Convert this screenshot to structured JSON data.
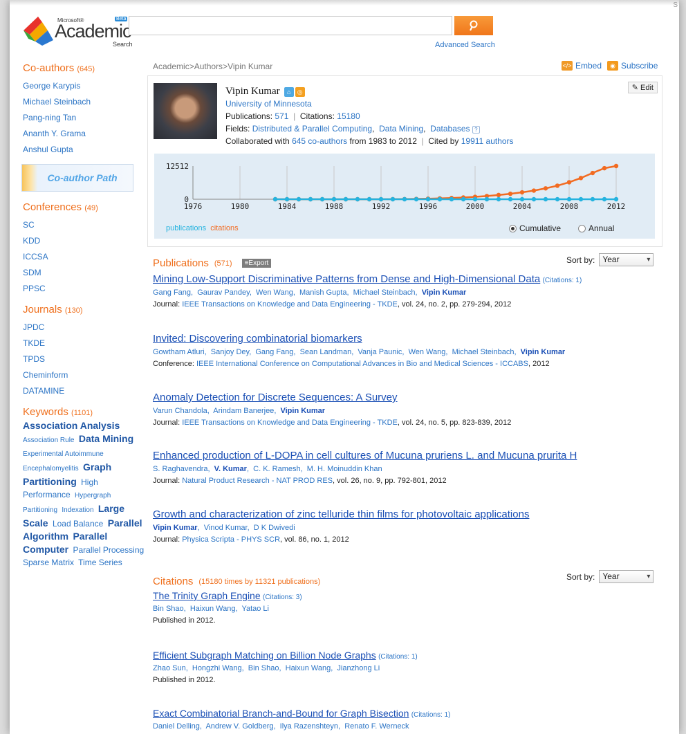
{
  "header": {
    "logo_small": "Microsoft®",
    "logo_beta": "Beta",
    "logo_main": "Academic",
    "logo_sub": "Search",
    "search_placeholder": "",
    "advanced_search": "Advanced Search",
    "corner_text": "S"
  },
  "sidebar": {
    "coauthors": {
      "title": "Co-authors",
      "count": "(645)",
      "items": [
        "George Karypis",
        "Michael Steinbach",
        "Pang-ning Tan",
        "Ananth Y. Grama",
        "Anshul Gupta"
      ]
    },
    "coauthor_path": "Co-author Path",
    "conferences": {
      "title": "Conferences",
      "count": "(49)",
      "items": [
        "SC",
        "KDD",
        "ICCSA",
        "SDM",
        "PPSC"
      ]
    },
    "journals": {
      "title": "Journals",
      "count": "(130)",
      "items": [
        "JPDC",
        "TKDE",
        "TPDS",
        "Cheminform",
        "DATAMINE"
      ]
    },
    "keywords": {
      "title": "Keywords",
      "count": "(1101)",
      "items": [
        {
          "text": "Association Analysis",
          "size": "large"
        },
        {
          "text": "Association Rule",
          "size": "small"
        },
        {
          "text": "Data Mining",
          "size": "large"
        },
        {
          "text": "Experimental Autoimmune Encephalomyelitis",
          "size": "small"
        },
        {
          "text": "Graph Partitioning",
          "size": "large"
        },
        {
          "text": "High Performance",
          "size": "medium"
        },
        {
          "text": "Hypergraph Partitioning",
          "size": "small"
        },
        {
          "text": "Indexation",
          "size": "small"
        },
        {
          "text": "Large Scale",
          "size": "large"
        },
        {
          "text": "Load Balance",
          "size": "medium"
        },
        {
          "text": "Parallel Algorithm",
          "size": "large"
        },
        {
          "text": "Parallel Computer",
          "size": "large"
        },
        {
          "text": "Parallel Processing",
          "size": "medium"
        },
        {
          "text": "Sparse Matrix",
          "size": "medium"
        },
        {
          "text": "Time Series",
          "size": "medium"
        }
      ]
    }
  },
  "breadcrumb": {
    "items": [
      "Academic",
      "Authors",
      "Vipin Kumar"
    ],
    "separator": ">"
  },
  "toolbar": {
    "embed": "Embed",
    "subscribe": "Subscribe",
    "edit": "Edit"
  },
  "profile": {
    "name": "Vipin Kumar",
    "affiliation": "University of Minnesota",
    "pubs_label": "Publications:",
    "pubs_value": "571",
    "sep": "|",
    "cites_label": "Citations:",
    "cites_value": "15180",
    "fields_label": "Fields:",
    "fields": [
      "Distributed & Parallel Computing",
      "Data Mining",
      "Databases"
    ],
    "collab_prefix": "Collaborated with",
    "collab_link": "645 co-authors",
    "collab_range": "from 1983 to 2012",
    "cited_prefix": "Cited by",
    "cited_link": "19911 authors"
  },
  "chart_data": {
    "type": "line",
    "x": [
      1983,
      1984,
      1985,
      1986,
      1987,
      1988,
      1989,
      1990,
      1991,
      1992,
      1993,
      1994,
      1995,
      1996,
      1997,
      1998,
      1999,
      2000,
      2001,
      2002,
      2003,
      2004,
      2005,
      2006,
      2007,
      2008,
      2009,
      2010,
      2011,
      2012
    ],
    "series": [
      {
        "name": "publications",
        "color": "#25b3df",
        "values": [
          1,
          3,
          6,
          9,
          13,
          17,
          22,
          28,
          34,
          41,
          50,
          60,
          72,
          86,
          100,
          115,
          132,
          150,
          170,
          192,
          215,
          240,
          268,
          300,
          335,
          370,
          410,
          455,
          510,
          571
        ]
      },
      {
        "name": "citations",
        "color": "#f26b21",
        "values": [
          0,
          0,
          0,
          0,
          0,
          0,
          0,
          0,
          0,
          0,
          20,
          60,
          120,
          210,
          320,
          460,
          650,
          900,
          1200,
          1600,
          2050,
          2600,
          3250,
          4100,
          5100,
          6400,
          8000,
          9900,
          11700,
          12512
        ]
      }
    ],
    "xticks": [
      "1976",
      "1980",
      "1984",
      "1988",
      "1992",
      "1996",
      "2000",
      "2004",
      "2008",
      "2012"
    ],
    "yticks": [
      "0",
      "12512"
    ],
    "xlim": [
      1976,
      2012
    ],
    "ylim": [
      0,
      12512
    ],
    "legend": [
      "publications",
      "citations"
    ],
    "modes": {
      "cumulative": "Cumulative",
      "annual": "Annual",
      "selected": "cumulative"
    }
  },
  "publications": {
    "title": "Publications",
    "count": "(571)",
    "export": "Export",
    "sort_label": "Sort by:",
    "sort_value": "Year",
    "items": [
      {
        "title": "Mining Low-Support Discriminative Patterns from Dense and High-Dimensional Data",
        "citations": "(Citations: 1)",
        "authors": [
          "Gang Fang",
          "Gaurav Pandey",
          "Wen Wang",
          "Manish Gupta",
          "Michael Steinbach",
          "Vipin Kumar"
        ],
        "venue_label": "Journal:",
        "venue": "IEEE Transactions on Knowledge and Data Engineering - TKDE",
        "details": ", vol. 24, no. 2, pp. 279-294, 2012"
      },
      {
        "title": "Invited: Discovering combinatorial biomarkers",
        "citations": "",
        "authors": [
          "Gowtham Atluri",
          "Sanjoy Dey",
          "Gang Fang",
          "Sean Landman",
          "Vanja Paunic",
          "Wen Wang",
          "Michael Steinbach",
          "Vipin Kumar"
        ],
        "venue_label": "Conference:",
        "venue": "IEEE International Conference on Computational Advances in Bio and Medical Sciences - ICCABS",
        "details": ", 2012"
      },
      {
        "title": "Anomaly Detection for Discrete Sequences: A Survey",
        "citations": "",
        "authors": [
          "Varun Chandola",
          "Arindam Banerjee",
          "Vipin Kumar"
        ],
        "venue_label": "Journal:",
        "venue": "IEEE Transactions on Knowledge and Data Engineering - TKDE",
        "details": ", vol. 24, no. 5, pp. 823-839, 2012"
      },
      {
        "title": "Enhanced production of L-DOPA in cell cultures of Mucuna pruriens L. and Mucuna prurita H",
        "citations": "",
        "authors": [
          "S. Raghavendra",
          "V. Kumar",
          "C. K. Ramesh",
          "M. H. Moinuddin Khan"
        ],
        "venue_label": "Journal:",
        "venue": "Natural Product Research - NAT PROD RES",
        "details": ", vol. 26, no. 9, pp. 792-801, 2012"
      },
      {
        "title": "Growth and characterization of zinc telluride thin films for photovoltaic applications",
        "citations": "",
        "authors": [
          "Vipin Kumar",
          "Vinod Kumar",
          "D K Dwivedi"
        ],
        "venue_label": "Journal:",
        "venue": "Physica Scripta - PHYS SCR",
        "details": ", vol. 86, no. 1, 2012"
      }
    ]
  },
  "citations": {
    "title": "Citations",
    "count": "(15180 times by 11321 publications)",
    "sort_label": "Sort by:",
    "sort_value": "Year",
    "items": [
      {
        "title": "The Trinity Graph Engine",
        "citations": "(Citations: 3)",
        "authors": [
          "Bin Shao",
          "Haixun Wang",
          "Yatao Li"
        ],
        "published": "Published in 2012."
      },
      {
        "title": "Efficient Subgraph Matching on Billion Node Graphs",
        "citations": "(Citations: 1)",
        "authors": [
          "Zhao Sun",
          "Hongzhi Wang",
          "Bin Shao",
          "Haixun Wang",
          "Jianzhong Li"
        ],
        "published": "Published in 2012."
      },
      {
        "title": "Exact Combinatorial Branch-and-Bound for Graph Bisection",
        "citations": "(Citations: 1)",
        "authors": [
          "Daniel Delling",
          "Andrew V. Goldberg",
          "Ilya Razenshteyn",
          "Renato F. Werneck"
        ],
        "published": ""
      }
    ]
  }
}
